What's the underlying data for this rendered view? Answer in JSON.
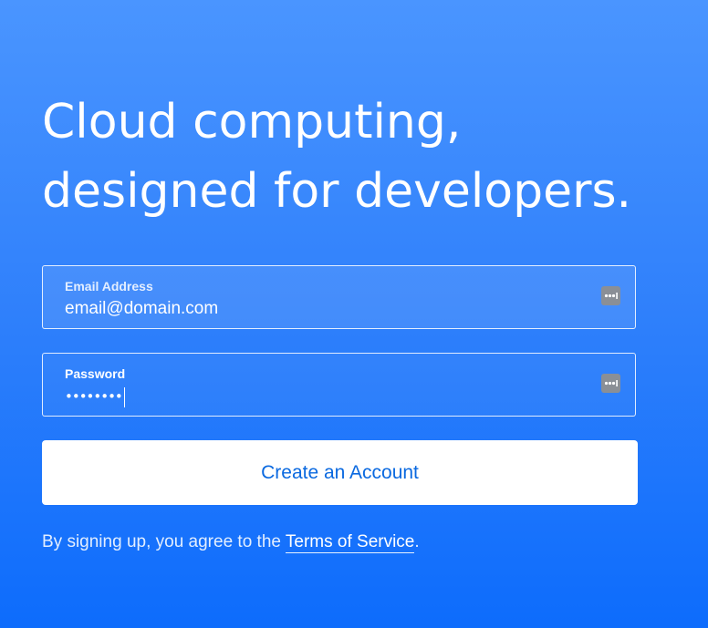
{
  "hero": {
    "line1": "Cloud computing,",
    "line2": "designed for developers."
  },
  "email_field": {
    "label": "Email Address",
    "value": "email@domain.com",
    "icon": "password-manager-icon"
  },
  "password_field": {
    "label": "Password",
    "masked_value": "••••••••",
    "icon": "password-manager-icon"
  },
  "create_button": {
    "label": "Create an Account"
  },
  "terms": {
    "prefix": "By signing up, you agree to the ",
    "link": "Terms of Service",
    "suffix": "."
  },
  "colors": {
    "background_top": "#4a95ff",
    "background_bottom": "#0d6cfc",
    "button_text": "#0a69e0",
    "button_bg": "#ffffff"
  }
}
